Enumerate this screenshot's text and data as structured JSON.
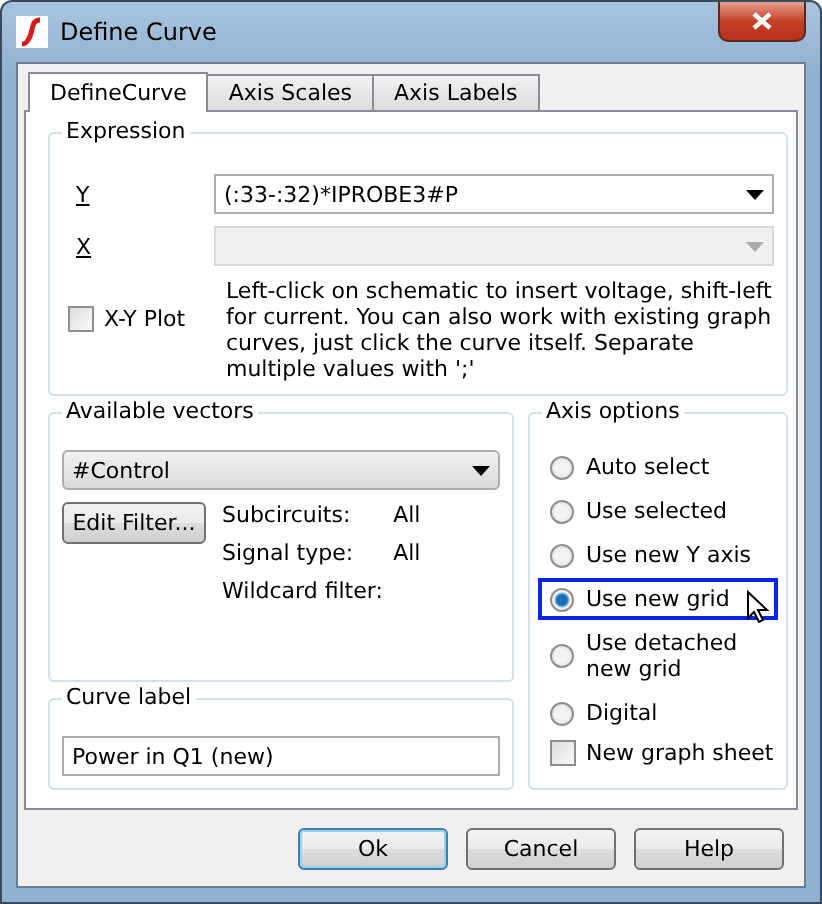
{
  "window": {
    "title": "Define Curve"
  },
  "tabs": [
    {
      "label": "DefineCurve",
      "selected": true
    },
    {
      "label": "Axis Scales",
      "selected": false
    },
    {
      "label": "Axis Labels",
      "selected": false
    }
  ],
  "expression": {
    "title": "Expression",
    "y": {
      "label": "Y",
      "value": "(:33-:32)*IPROBE3#P",
      "disabled": false
    },
    "x": {
      "label": "X",
      "disabled": true
    },
    "xy_plot": {
      "label": "X-Y Plot",
      "checked": false
    },
    "hint": "Left-click on schematic to insert voltage, shift-left for current. You can also work with existing graph curves, just click the curve itself. Separate multiple values with ';'"
  },
  "available_vectors": {
    "title": "Available vectors",
    "value": "#Control",
    "button": "Edit Filter...",
    "filters": [
      {
        "label": "Subcircuits:",
        "value": "All"
      },
      {
        "label": "Signal type:",
        "value": "All"
      },
      {
        "label": "Wildcard filter:"
      }
    ]
  },
  "curve_label": {
    "title": "Curve label",
    "value": "Power in Q1 (new)"
  },
  "axis_options": {
    "title": "Axis options",
    "items": [
      {
        "kind": "radio",
        "label": "Auto select",
        "selected": false,
        "highlighted": false
      },
      {
        "kind": "radio",
        "label": "Use selected",
        "selected": false,
        "highlighted": false
      },
      {
        "kind": "radio",
        "label": "Use new Y axis",
        "selected": false,
        "highlighted": false
      },
      {
        "kind": "radio",
        "label": "Use new grid",
        "selected": true,
        "highlighted": true
      },
      {
        "kind": "radio",
        "label": "Use detached new grid",
        "selected": false,
        "highlighted": false
      },
      {
        "kind": "radio",
        "label": "Digital",
        "selected": false,
        "highlighted": false
      },
      {
        "kind": "checkbox",
        "label": "New graph sheet",
        "checked": false
      }
    ]
  },
  "buttons": [
    {
      "label": "Ok",
      "default": true
    },
    {
      "label": "Cancel",
      "default": false
    },
    {
      "label": "Help",
      "default": false
    }
  ]
}
